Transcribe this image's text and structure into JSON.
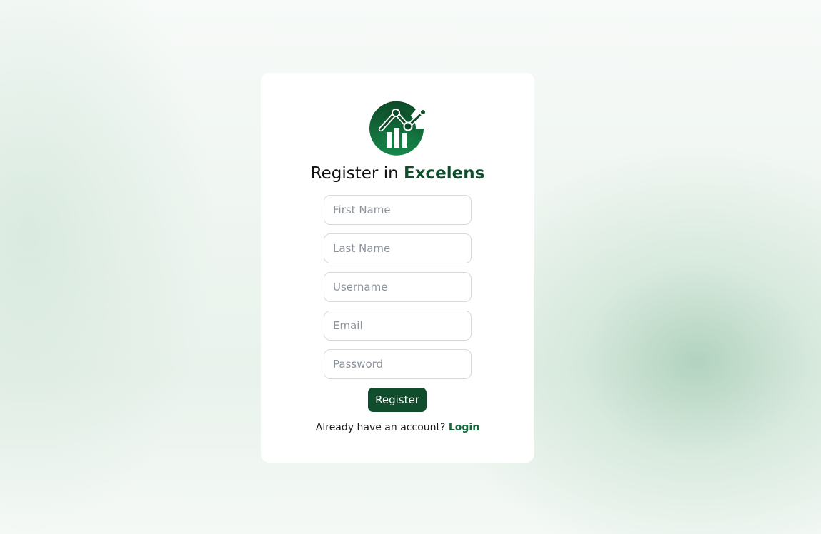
{
  "heading": {
    "prefix": "Register in ",
    "brand": "Excelens"
  },
  "logo": {
    "icon": "growth-chart-logo-icon",
    "colors": [
      "#0f4d2c",
      "#16874a"
    ]
  },
  "form": {
    "first_name_placeholder": "First Name",
    "last_name_placeholder": "Last Name",
    "username_placeholder": "Username",
    "email_placeholder": "Email",
    "password_placeholder": "Password",
    "submit_label": "Register"
  },
  "footer": {
    "prompt": "Already have an account? ",
    "login_label": "Login"
  },
  "colors": {
    "accent": "#0f4d2c",
    "link": "#0f6b38",
    "background_tint": "#c4ddcd"
  }
}
